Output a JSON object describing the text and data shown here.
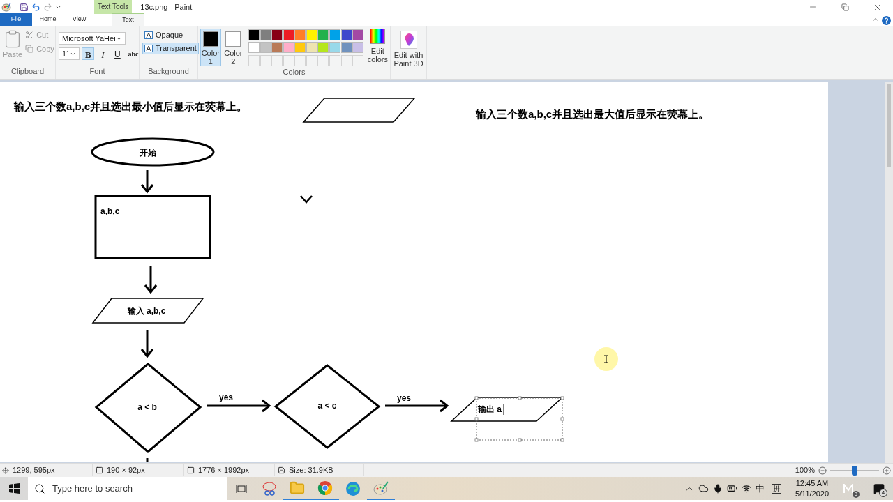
{
  "window": {
    "title": "13c.png - Paint",
    "context_tab": "Text Tools"
  },
  "tabs": [
    {
      "label": "File",
      "kind": "file",
      "selected": false
    },
    {
      "label": "Home",
      "kind": "tab",
      "selected": false
    },
    {
      "label": "View",
      "kind": "tab",
      "selected": false
    },
    {
      "label": "Text",
      "kind": "tab",
      "selected": true
    }
  ],
  "clipboard": {
    "group": "Clipboard",
    "items": [
      {
        "label": "Paste",
        "disabled": true
      },
      {
        "label": "Cut",
        "disabled": true
      },
      {
        "label": "Copy",
        "disabled": true
      }
    ]
  },
  "font": {
    "group": "Font",
    "family": "Microsoft YaHei",
    "size": "11",
    "styles": [
      {
        "label": "B",
        "kind": "bold",
        "selected": true
      },
      {
        "label": "I",
        "kind": "italic",
        "selected": false
      },
      {
        "label": "U",
        "kind": "underline",
        "selected": false
      },
      {
        "label": "abc",
        "kind": "strike",
        "selected": false
      }
    ]
  },
  "background": {
    "group": "Background",
    "options": [
      {
        "label": "Opaque",
        "selected": false
      },
      {
        "label": "Transparent",
        "selected": true
      }
    ]
  },
  "colors": {
    "group": "Colors",
    "slots": [
      {
        "label": "Color",
        "number": "1",
        "color": "#000000",
        "selected": true
      },
      {
        "label": "Color",
        "number": "2",
        "color": "#ffffff",
        "selected": false
      }
    ],
    "palette": [
      {
        "kind": "swatch",
        "color": "#000000"
      },
      {
        "kind": "swatch",
        "color": "#7f7f7f"
      },
      {
        "kind": "swatch",
        "color": "#880015"
      },
      {
        "kind": "swatch",
        "color": "#ed1c24"
      },
      {
        "kind": "swatch",
        "color": "#ff7f27"
      },
      {
        "kind": "swatch",
        "color": "#fff200"
      },
      {
        "kind": "swatch",
        "color": "#22b14c"
      },
      {
        "kind": "swatch",
        "color": "#00a2e8"
      },
      {
        "kind": "swatch",
        "color": "#3f48cc"
      },
      {
        "kind": "swatch",
        "color": "#a349a4"
      },
      {
        "kind": "swatch",
        "color": "#ffffff"
      },
      {
        "kind": "swatch",
        "color": "#c3c3c3"
      },
      {
        "kind": "swatch",
        "color": "#b97a57"
      },
      {
        "kind": "swatch",
        "color": "#ffaec9"
      },
      {
        "kind": "swatch",
        "color": "#ffc90e"
      },
      {
        "kind": "swatch",
        "color": "#efe4b0"
      },
      {
        "kind": "swatch",
        "color": "#b5e61d"
      },
      {
        "kind": "swatch",
        "color": "#99d9ea"
      },
      {
        "kind": "swatch",
        "color": "#7092be"
      },
      {
        "kind": "swatch",
        "color": "#c8bfe7"
      },
      {
        "kind": "empty"
      },
      {
        "kind": "empty"
      },
      {
        "kind": "empty"
      },
      {
        "kind": "empty"
      },
      {
        "kind": "empty"
      },
      {
        "kind": "empty"
      },
      {
        "kind": "empty"
      },
      {
        "kind": "empty"
      },
      {
        "kind": "empty"
      },
      {
        "kind": "empty"
      }
    ],
    "edit_colors": [
      "Edit",
      "colors"
    ]
  },
  "paint3d": [
    "Edit with",
    "Paint 3D"
  ],
  "canvas": {
    "heading_left": "输入三个数a,b,c并且选出最小值后显示在荧幕上。",
    "heading_right": "输入三个数a,b,c并且选出最大值后显示在荧幕上。",
    "start": "开始",
    "process": "a,b,c",
    "input": "输入  a,b,c",
    "decision_1": "a  <  b",
    "decision_2": "a  <  c",
    "yes_1": "yes",
    "yes_2": "yes",
    "output": "输出  a"
  },
  "status_bar": {
    "cursor": "1299, 595px",
    "selection": "190 × 92px",
    "image_size": "1776 × 1992px",
    "file_size": "Size: 31.9KB",
    "zoom": "100%",
    "level": 0.5
  },
  "taskbar": {
    "search_placeholder": "Type here to search",
    "apps": [
      {
        "kind": "snip",
        "running": false
      },
      {
        "kind": "folder",
        "running": true
      },
      {
        "kind": "chrome",
        "running": true
      },
      {
        "kind": "edge",
        "running": false
      },
      {
        "kind": "paint",
        "running": true
      }
    ],
    "ime_mode": "中",
    "ime": "拼",
    "time": "12:45 AM",
    "date": "5/11/2020",
    "tray_badge": "3",
    "notifications": "4"
  }
}
